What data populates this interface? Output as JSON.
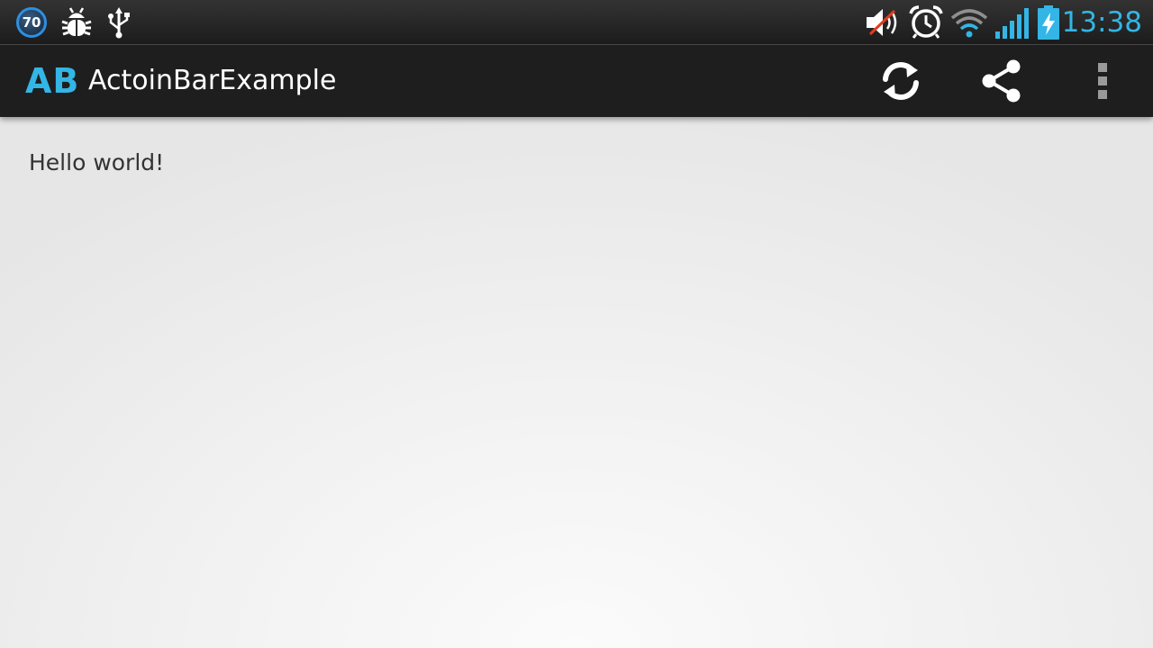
{
  "status_bar": {
    "notification_badge": "70",
    "time": "13:38",
    "left_icons": [
      "notification-badge-icon",
      "bug-icon",
      "usb-icon"
    ],
    "right_icons": [
      "volume-muted-icon",
      "alarm-icon",
      "wifi-icon",
      "signal-icon",
      "battery-charging-icon"
    ],
    "accent_color": "#33b5e5"
  },
  "action_bar": {
    "logo_text": "AB",
    "title": "ActoinBarExample",
    "actions": [
      "refresh-icon",
      "share-icon",
      "overflow-menu-icon"
    ]
  },
  "content": {
    "text": "Hello world!"
  }
}
